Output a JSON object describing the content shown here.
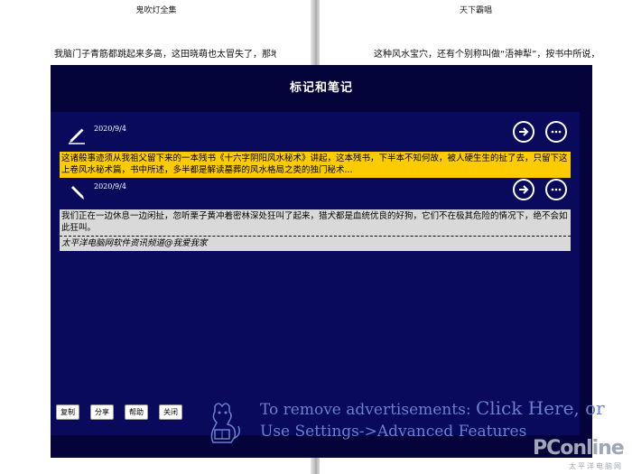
{
  "book": {
    "left_header": "鬼吹灯全集",
    "right_header": "天下霸唱",
    "left_text": "我脑门子青筋都跳起来多高，这田晓萌也太冒失了，那地方全",
    "right_text": "这种风水宝穴，还有个别称叫做“浯神犁”，按书中所说，最适"
  },
  "modal": {
    "title": "标记和笔记"
  },
  "notes": [
    {
      "date": "2020/9/4",
      "highlight": "这诸般事迹须从我祖父留下来的一本残书《十六字阴阳风水秘术》讲起，这本残书，下半本不知何故，被人硬生生的扯了去，只留下这上卷风水秘术篇，书中所述，多半都是解读墓葬的风水格局之类的独门秘术...",
      "highlight_color": "#fccc00"
    },
    {
      "date": "2020/9/4",
      "highlight": "我们正在一边休息一边闲扯，忽听栗子黄冲着密林深处狂叫了起来，猎犬都是血统优良的好狗，它们不在极其危险的情况下，绝不会如此狂叫。",
      "note": "太平洋电脑网软件资讯频道@我爱我家",
      "highlight_color": "#d9d9d9"
    }
  ],
  "buttons": {
    "copy": "复制",
    "share": "分享",
    "help": "帮助",
    "close": "关闭"
  },
  "ad": {
    "line1_a": "To remove advertisements: ",
    "line1_b": "Click Here, or",
    "line2": "Use Settings->Advanced Features"
  },
  "watermark": {
    "logo": "PConline",
    "sub": "太平洋电脑网"
  },
  "colors": {
    "modal_bg": "#04043b",
    "notes_bg": "#0a0a5c",
    "highlight_yellow": "#fccc00",
    "highlight_grey": "#d9d9d9",
    "ad_text": "#6a7fd1"
  },
  "icons": {
    "note_pen": "pencil-icon",
    "go": "arrow-right-circle-icon",
    "more": "more-dots-circle-icon",
    "mascot": "dragon-mascot-icon"
  }
}
